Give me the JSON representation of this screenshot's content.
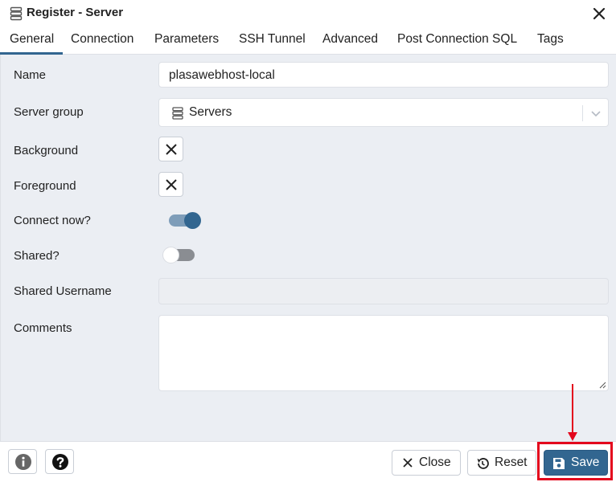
{
  "window": {
    "title": "Register - Server",
    "icon": "server-icon",
    "close_icon": "close-icon"
  },
  "tabs": [
    {
      "label": "General",
      "active": true
    },
    {
      "label": "Connection"
    },
    {
      "label": "Parameters"
    },
    {
      "label": "SSH Tunnel"
    },
    {
      "label": "Advanced"
    },
    {
      "label": "Post Connection SQL"
    },
    {
      "label": "Tags"
    }
  ],
  "form": {
    "name": {
      "label": "Name",
      "value": "plasawebhost-local"
    },
    "server_group": {
      "label": "Server group",
      "value": "Servers",
      "icon": "server-group-icon"
    },
    "background": {
      "label": "Background",
      "icon": "clear-x-icon"
    },
    "foreground": {
      "label": "Foreground",
      "icon": "clear-x-icon"
    },
    "connect_now": {
      "label": "Connect now?",
      "on": true
    },
    "shared": {
      "label": "Shared?",
      "on": false
    },
    "shared_username": {
      "label": "Shared Username",
      "value": ""
    },
    "comments": {
      "label": "Comments",
      "value": ""
    }
  },
  "footer": {
    "info_icon": "info-icon",
    "help_icon": "help-icon",
    "close_label": "Close",
    "reset_label": "Reset",
    "save_label": "Save"
  },
  "colors": {
    "accent": "#326690",
    "content_bg": "#ebeef3",
    "annotation": "#e3071d"
  }
}
